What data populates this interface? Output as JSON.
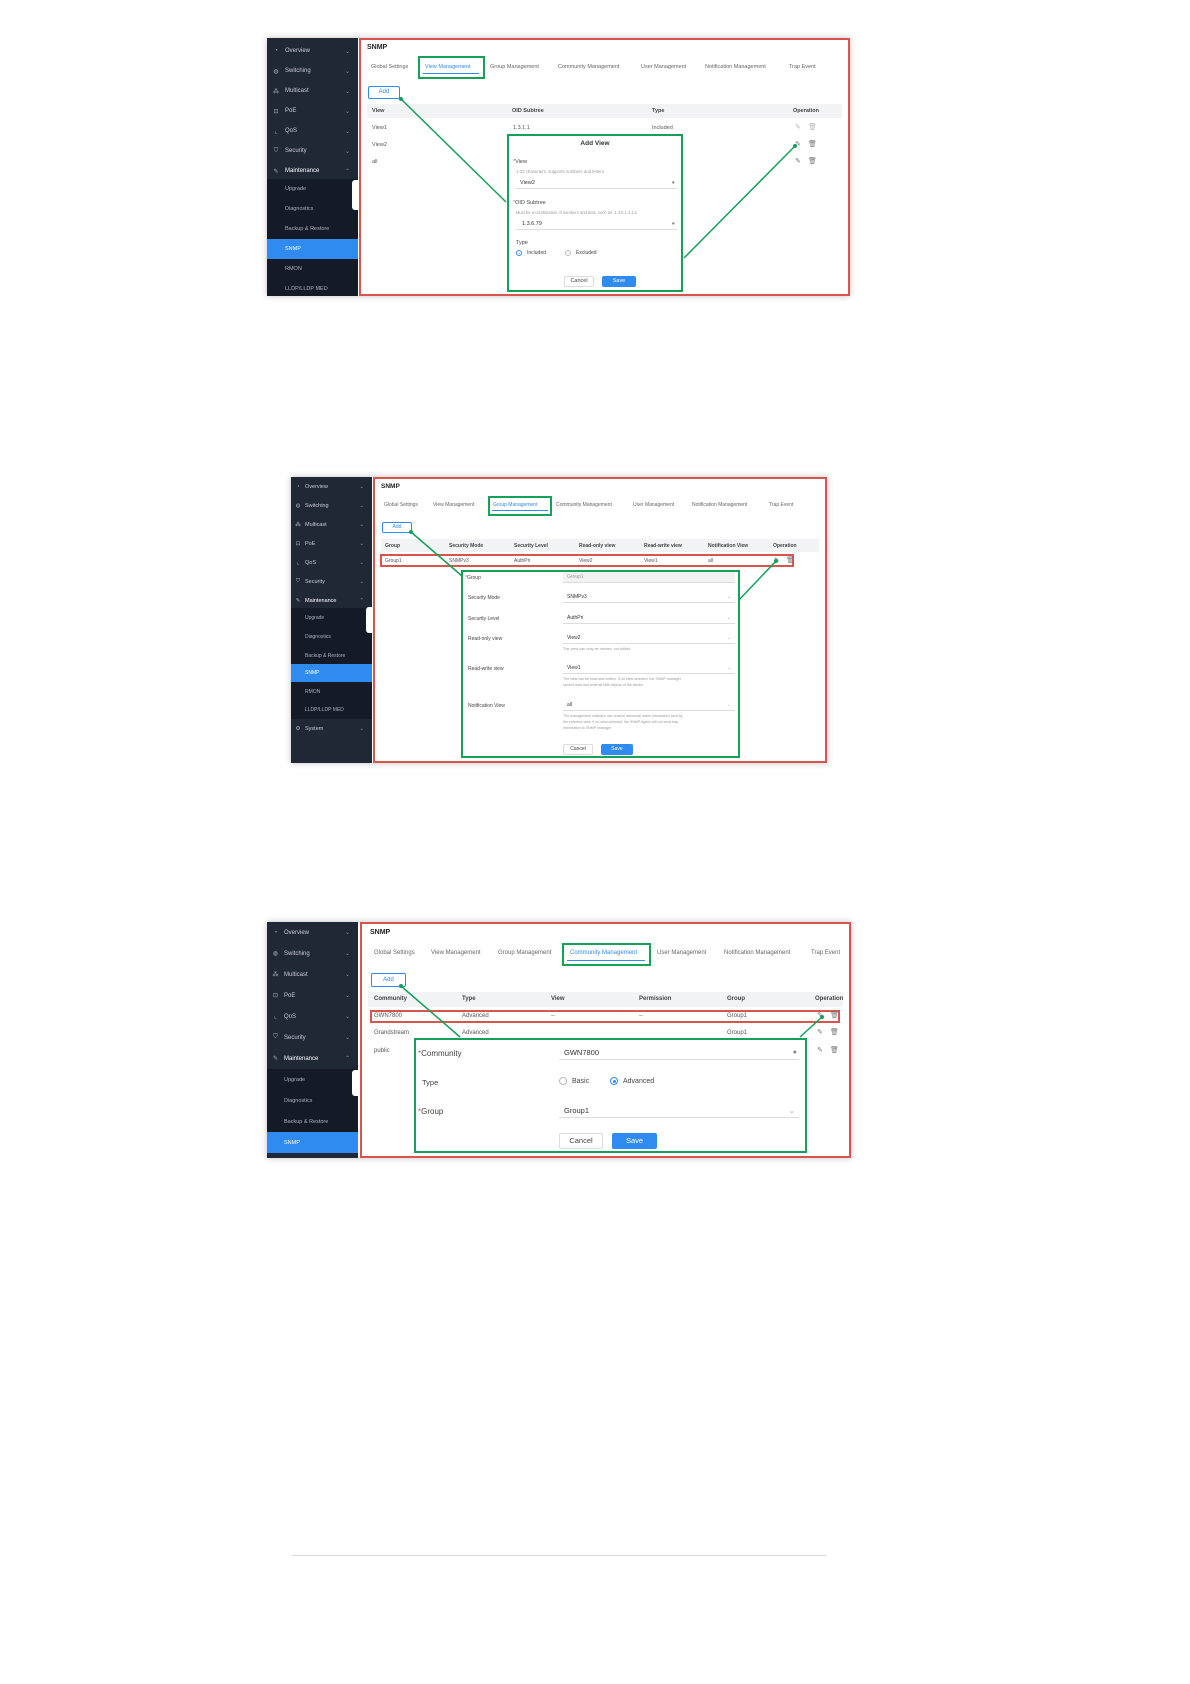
{
  "screenshots": [
    {
      "sidebar": {
        "items": [
          {
            "label": "Overview",
            "icon": "gauge-icon",
            "chevron": "⌄"
          },
          {
            "label": "Switching",
            "icon": "globe-icon",
            "chevron": "⌄"
          },
          {
            "label": "Multicast",
            "icon": "multicast-icon",
            "chevron": "⌄"
          },
          {
            "label": "PoE",
            "icon": "poe-icon",
            "chevron": "⌄"
          },
          {
            "label": "QoS",
            "icon": "chart-icon",
            "chevron": "⌄"
          },
          {
            "label": "Security",
            "icon": "shield-icon",
            "chevron": "⌄"
          },
          {
            "label": "Maintenance",
            "icon": "wrench-icon",
            "chevron": "⌃"
          }
        ],
        "subitems": [
          "Upgrade",
          "Diagnostics",
          "Backup & Restore",
          "SNMP",
          "RMON",
          "LLDP/LLDP MED"
        ]
      },
      "title": "SNMP",
      "tabs": [
        "Global Settings",
        "View Management",
        "Group Management",
        "Community Management",
        "User Management",
        "Notification Management",
        "Trap Event"
      ],
      "active_tab": "View Management",
      "add_label": "Add",
      "columns": [
        "View",
        "OID Subtree",
        "Type",
        "Operation"
      ],
      "rows": [
        [
          "View1",
          "1.3.1.1",
          "Included"
        ],
        [
          "View2",
          "",
          ""
        ],
        [
          "all",
          "",
          ""
        ]
      ],
      "dialog": {
        "title": "Add View",
        "view_label": "View",
        "view_hint": "1-32 characters, supports numbers and letters",
        "view_value": "View2",
        "oid_label": "OID Subtree",
        "oid_hint": "Must be a combination of numbers and dots, such as .1.3.6.1.2.1.2",
        "oid_value": "1.3.6.79",
        "type_label": "Type",
        "opt_included": "Included",
        "opt_excluded": "Excluded",
        "cancel": "Cancel",
        "save": "Save"
      }
    },
    {
      "sidebar": {
        "items": [
          {
            "label": "Overview",
            "icon": "gauge-icon",
            "chevron": "⌄"
          },
          {
            "label": "Switching",
            "icon": "globe-icon",
            "chevron": "⌄"
          },
          {
            "label": "Multicast",
            "icon": "multicast-icon",
            "chevron": "⌄"
          },
          {
            "label": "PoE",
            "icon": "poe-icon",
            "chevron": "⌄"
          },
          {
            "label": "QoS",
            "icon": "chart-icon",
            "chevron": "⌄"
          },
          {
            "label": "Security",
            "icon": "shield-icon",
            "chevron": "⌄"
          },
          {
            "label": "Maintenance",
            "icon": "wrench-icon",
            "chevron": "⌃"
          }
        ],
        "subitems": [
          "Upgrade",
          "Diagnostics",
          "Backup & Restore",
          "SNMP",
          "RMON",
          "LLDP/LLDP MED"
        ],
        "extra": {
          "label": "System",
          "icon": "gear-icon",
          "chevron": "⌄"
        }
      },
      "title": "SNMP",
      "tabs": [
        "Global Settings",
        "View Management",
        "Group Management",
        "Community Management",
        "User Management",
        "Notification Management",
        "Trap Event"
      ],
      "active_tab": "Group Management",
      "add_label": "Add",
      "columns": [
        "Group",
        "Security Mode",
        "Security Level",
        "Read-only view",
        "Read-write view",
        "Notification View",
        "Operation"
      ],
      "rows": [
        [
          "Group1",
          "SNMPv3",
          "AuthPri",
          "View2",
          "View1",
          "all"
        ]
      ],
      "dialog": {
        "group_label": "Group",
        "group_value": "Group1",
        "secmode_label": "Security Mode",
        "secmode_value": "SNMPv3",
        "seclevel_label": "Security Level",
        "seclevel_value": "AuthPri",
        "ro_label": "Read-only view",
        "ro_value": "View2",
        "ro_hint": "The view can only be viewed, not edited",
        "rw_label": "Read-write view",
        "rw_value": "View1",
        "rw_hint1": "The view can be read and written. If no view selected, the SNMP manager",
        "rw_hint2": "cannot read and write all MIB objects of the device",
        "nv_label": "Notification View",
        "nv_value": "all",
        "nv_hint1": "The management software can receive abnormal alarm information sent by",
        "nv_hint2": "the selected view. If no view selected, the SNMP Agent will not send trap",
        "nv_hint3": "information to SNMP manager",
        "cancel": "Cancel",
        "save": "Save"
      }
    },
    {
      "sidebar": {
        "items": [
          {
            "label": "Overview",
            "icon": "gauge-icon",
            "chevron": "⌄"
          },
          {
            "label": "Switching",
            "icon": "globe-icon",
            "chevron": "⌄"
          },
          {
            "label": "Multicast",
            "icon": "multicast-icon",
            "chevron": "⌄"
          },
          {
            "label": "PoE",
            "icon": "poe-icon",
            "chevron": "⌄"
          },
          {
            "label": "QoS",
            "icon": "chart-icon",
            "chevron": "⌄"
          },
          {
            "label": "Security",
            "icon": "shield-icon",
            "chevron": "⌄"
          },
          {
            "label": "Maintenance",
            "icon": "wrench-icon",
            "chevron": "⌃"
          }
        ],
        "subitems": [
          "Upgrade",
          "Diagnostics",
          "Backup & Restore",
          "SNMP"
        ]
      },
      "title": "SNMP",
      "tabs": [
        "Global Settings",
        "View Management",
        "Group Management",
        "Community Management",
        "User Management",
        "Notification Management",
        "Trap Event"
      ],
      "active_tab": "Community Management",
      "add_label": "Add",
      "columns": [
        "Community",
        "Type",
        "View",
        "Permission",
        "Group",
        "Operation"
      ],
      "rows": [
        [
          "GWN7800",
          "Advanced",
          "--",
          "--",
          "Group1"
        ],
        [
          "Grandstream",
          "Advanced",
          "",
          "",
          "Group1"
        ],
        [
          "public",
          "",
          "",
          "",
          ""
        ]
      ],
      "dialog": {
        "community_label": "Community",
        "community_value": "GWN7800",
        "type_label": "Type",
        "opt_basic": "Basic",
        "opt_advanced": "Advanced",
        "group_label": "Group",
        "group_value": "Group1",
        "cancel": "Cancel",
        "save": "Save"
      }
    }
  ],
  "icons": {
    "edit": "edit-icon",
    "delete": "trash-icon",
    "clear": "clear-circle-icon",
    "dropdown": "chevron-down-icon"
  },
  "colors": {
    "sidebar_bg": "#202836",
    "sidebar_active": "#2f8bf0",
    "highlight_green": "#16a05a",
    "highlight_red": "#d9534f",
    "accent_blue": "#2f8bf0"
  }
}
